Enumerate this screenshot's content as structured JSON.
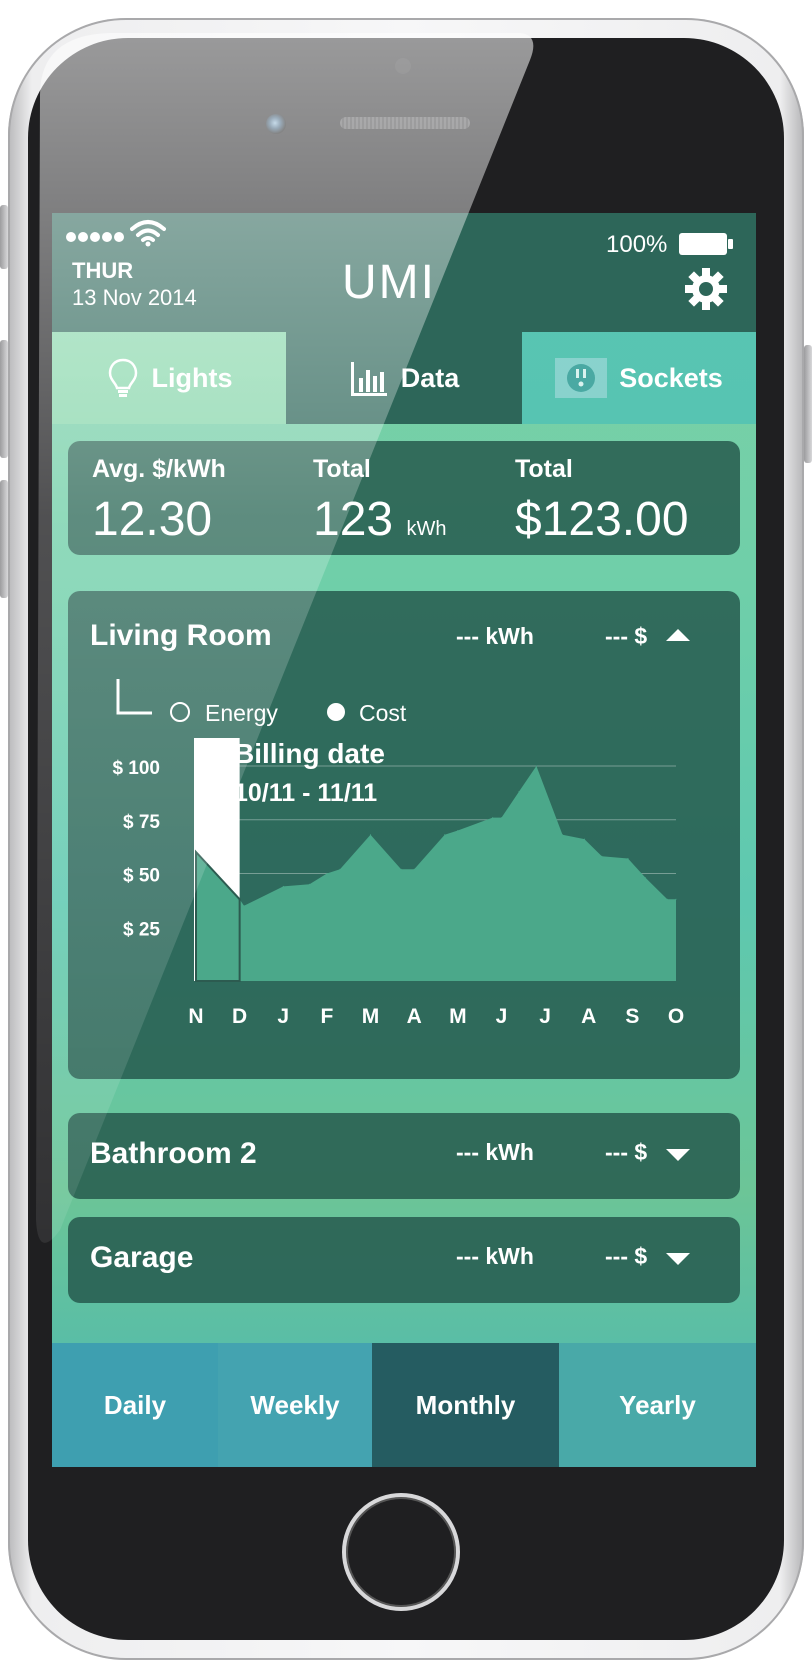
{
  "status_bar": {
    "day": "THUR",
    "date": "13 Nov 2014",
    "battery": "100%"
  },
  "app": {
    "title": "UMI"
  },
  "tabs": [
    {
      "label": "Lights",
      "icon": "lightbulb-icon"
    },
    {
      "label": "Data",
      "icon": "bar-chart-icon",
      "active": true
    },
    {
      "label": "Sockets",
      "icon": "socket-icon"
    }
  ],
  "summary": {
    "avg": {
      "label": "Avg. $/kWh",
      "value": "12.30"
    },
    "energy": {
      "label": "Total",
      "value": "123",
      "unit": "kWh"
    },
    "cost": {
      "label": "Total",
      "value": "$123.00"
    }
  },
  "rooms": [
    {
      "name": "Living Room",
      "kwh": "---  kWh",
      "cost": "--- $",
      "expanded": true
    },
    {
      "name": "Bathroom 2",
      "kwh": "---  kWh",
      "cost": "--- $",
      "expanded": false
    },
    {
      "name": "Garage",
      "kwh": "--- kWh",
      "cost": "--- $",
      "expanded": false
    }
  ],
  "chart_data": {
    "type": "area",
    "legend": {
      "energy": "Energy",
      "cost": "Cost",
      "selected": "Cost"
    },
    "tooltip": {
      "title": "Billing date",
      "range": "10/11 - 11/11"
    },
    "y_tick_labels": [
      "$ 100",
      "$ 75",
      "$ 50",
      "$ 25"
    ],
    "y_ticks": [
      100,
      75,
      50,
      25
    ],
    "ylim": [
      0,
      100
    ],
    "grid": true,
    "categories": [
      "N",
      "D",
      "J",
      "F",
      "M",
      "A",
      "M",
      "J",
      "J",
      "A",
      "S",
      "O"
    ],
    "x": [
      0,
      1,
      1.1,
      2,
      2.6,
      3,
      3.3,
      4,
      4.7,
      5,
      5.7,
      6,
      6.8,
      7,
      7.4,
      7.8,
      8.4,
      8.9,
      9.3,
      9.9,
      10.3,
      10.8,
      11
    ],
    "values": [
      60,
      38,
      35,
      44,
      45,
      50,
      52,
      68,
      52,
      52,
      68,
      70,
      76,
      76,
      88,
      100,
      68,
      66,
      58,
      57,
      48,
      38,
      38
    ],
    "highlight_category": "N",
    "colors": {
      "area": "#4ba88a",
      "highlight": "#ffffff"
    }
  },
  "periods": [
    {
      "label": "Daily"
    },
    {
      "label": "Weekly"
    },
    {
      "label": "Monthly",
      "active": true
    },
    {
      "label": "Yearly"
    }
  ],
  "colors": {
    "header": "#2d6659",
    "card": "#23554b",
    "accent_area": "#4ba88a",
    "period_active": "#255c61"
  }
}
